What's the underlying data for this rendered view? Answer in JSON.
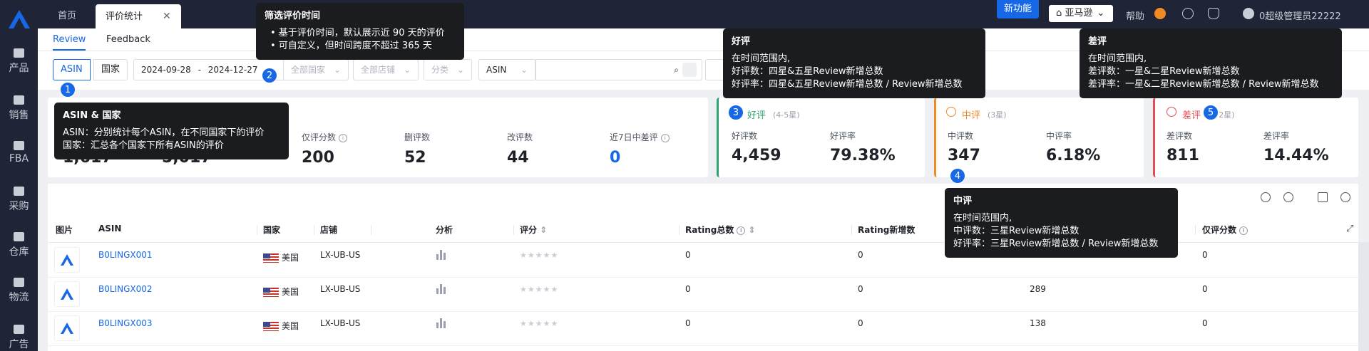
{
  "nav": {
    "items": [
      {
        "label": "产品",
        "icon": "product-icon"
      },
      {
        "label": "销售",
        "icon": "sales-icon"
      },
      {
        "label": "FBA",
        "icon": "fba-icon"
      },
      {
        "label": "采购",
        "icon": "purchase-icon"
      },
      {
        "label": "仓库",
        "icon": "warehouse-icon"
      },
      {
        "label": "物流",
        "icon": "logistics-icon"
      },
      {
        "label": "广告",
        "icon": "ads-icon"
      }
    ]
  },
  "topbar": {
    "tabs": [
      {
        "label": "首页"
      },
      {
        "label": "评价统计"
      }
    ],
    "close_glyph": "✕",
    "new_feature": "新功能",
    "store": "亚马逊",
    "help": "帮助",
    "user": "0超级管理员22222"
  },
  "subtabs": [
    {
      "label": "Review"
    },
    {
      "label": "Feedback"
    }
  ],
  "filters": {
    "seg_asin": "ASIN",
    "seg_country": "国家",
    "date_start": "2024-09-28",
    "date_sep": "-",
    "date_end": "2024-12-27",
    "all_countries": "全部国家",
    "all_stores": "全部店铺",
    "category": "分类",
    "search_type": "ASIN"
  },
  "stats": {
    "left": [
      {
        "label": "",
        "value": "1,617"
      },
      {
        "label": "",
        "value": "5,017"
      },
      {
        "label": "仅评分数",
        "value": "200"
      },
      {
        "label": "删评数",
        "value": "52"
      },
      {
        "label": "改评数",
        "value": "44"
      },
      {
        "label": "近7日中差评",
        "value": "0"
      }
    ],
    "good": {
      "title": "好评",
      "range": "(4-5星)",
      "count_label": "好评数",
      "count": "4,459",
      "rate_label": "好评率",
      "rate": "79.38%",
      "color": "#2ba471"
    },
    "mid": {
      "title": "中评",
      "range": "(3星)",
      "count_label": "中评数",
      "count": "347",
      "rate_label": "中评率",
      "rate": "6.18%",
      "color": "#f08a24"
    },
    "bad": {
      "title": "差评",
      "range": "(1-2星)",
      "count_label": "差评数",
      "count": "811",
      "rate_label": "差评率",
      "rate": "14.44%",
      "color": "#e34d59"
    }
  },
  "table": {
    "headers": [
      "图片",
      "ASIN",
      "国家",
      "店铺",
      "分析",
      "评分",
      "Rating总数",
      "Rating新增数",
      "",
      "仅评分数"
    ],
    "rows": [
      {
        "asin": "B0LINGX001",
        "country": "美国",
        "store": "LX-UB-US",
        "stars": "★★★★★",
        "rating_total": "0",
        "rating_new": "0",
        "reviews": "",
        "rating_only": "0"
      },
      {
        "asin": "B0LINGX002",
        "country": "美国",
        "store": "LX-UB-US",
        "stars": "★★★★★",
        "rating_total": "0",
        "rating_new": "0",
        "reviews": "289",
        "rating_only": "0"
      },
      {
        "asin": "B0LINGX003",
        "country": "美国",
        "store": "LX-UB-US",
        "stars": "★★★★★",
        "rating_total": "0",
        "rating_new": "0",
        "reviews": "138",
        "rating_only": "0"
      }
    ]
  },
  "tooltips": {
    "date": {
      "title": "筛选评价时间",
      "lines": [
        "• 基于评价时间，默认展示近 90 天的评价",
        "• 可自定义，但时间跨度不超过 365 天"
      ]
    },
    "asin": {
      "title": "ASIN & 国家",
      "lines": [
        "ASIN：分别统计每个ASIN，在不同国家下的评价",
        "国家：汇总各个国家下所有ASIN的评价"
      ]
    },
    "good": {
      "title": "好评",
      "lines": [
        "在时间范围内,",
        "好评数：四星&五星Review新增总数",
        "好评率：四星&五星Review新增总数 / Review新增总数"
      ]
    },
    "mid": {
      "title": "中评",
      "lines": [
        "在时间范围内,",
        "中评数：三星Review新增总数",
        "好评率：三星Review新增总数 / Review新增总数"
      ]
    },
    "bad": {
      "title": "差评",
      "lines": [
        "在时间范围内,",
        "差评数：一星&二星Review新增总数",
        "差评率：一星&二星Review新增总数 / Review新增总数"
      ]
    }
  },
  "badges": [
    "1",
    "2",
    "3",
    "4",
    "5"
  ]
}
